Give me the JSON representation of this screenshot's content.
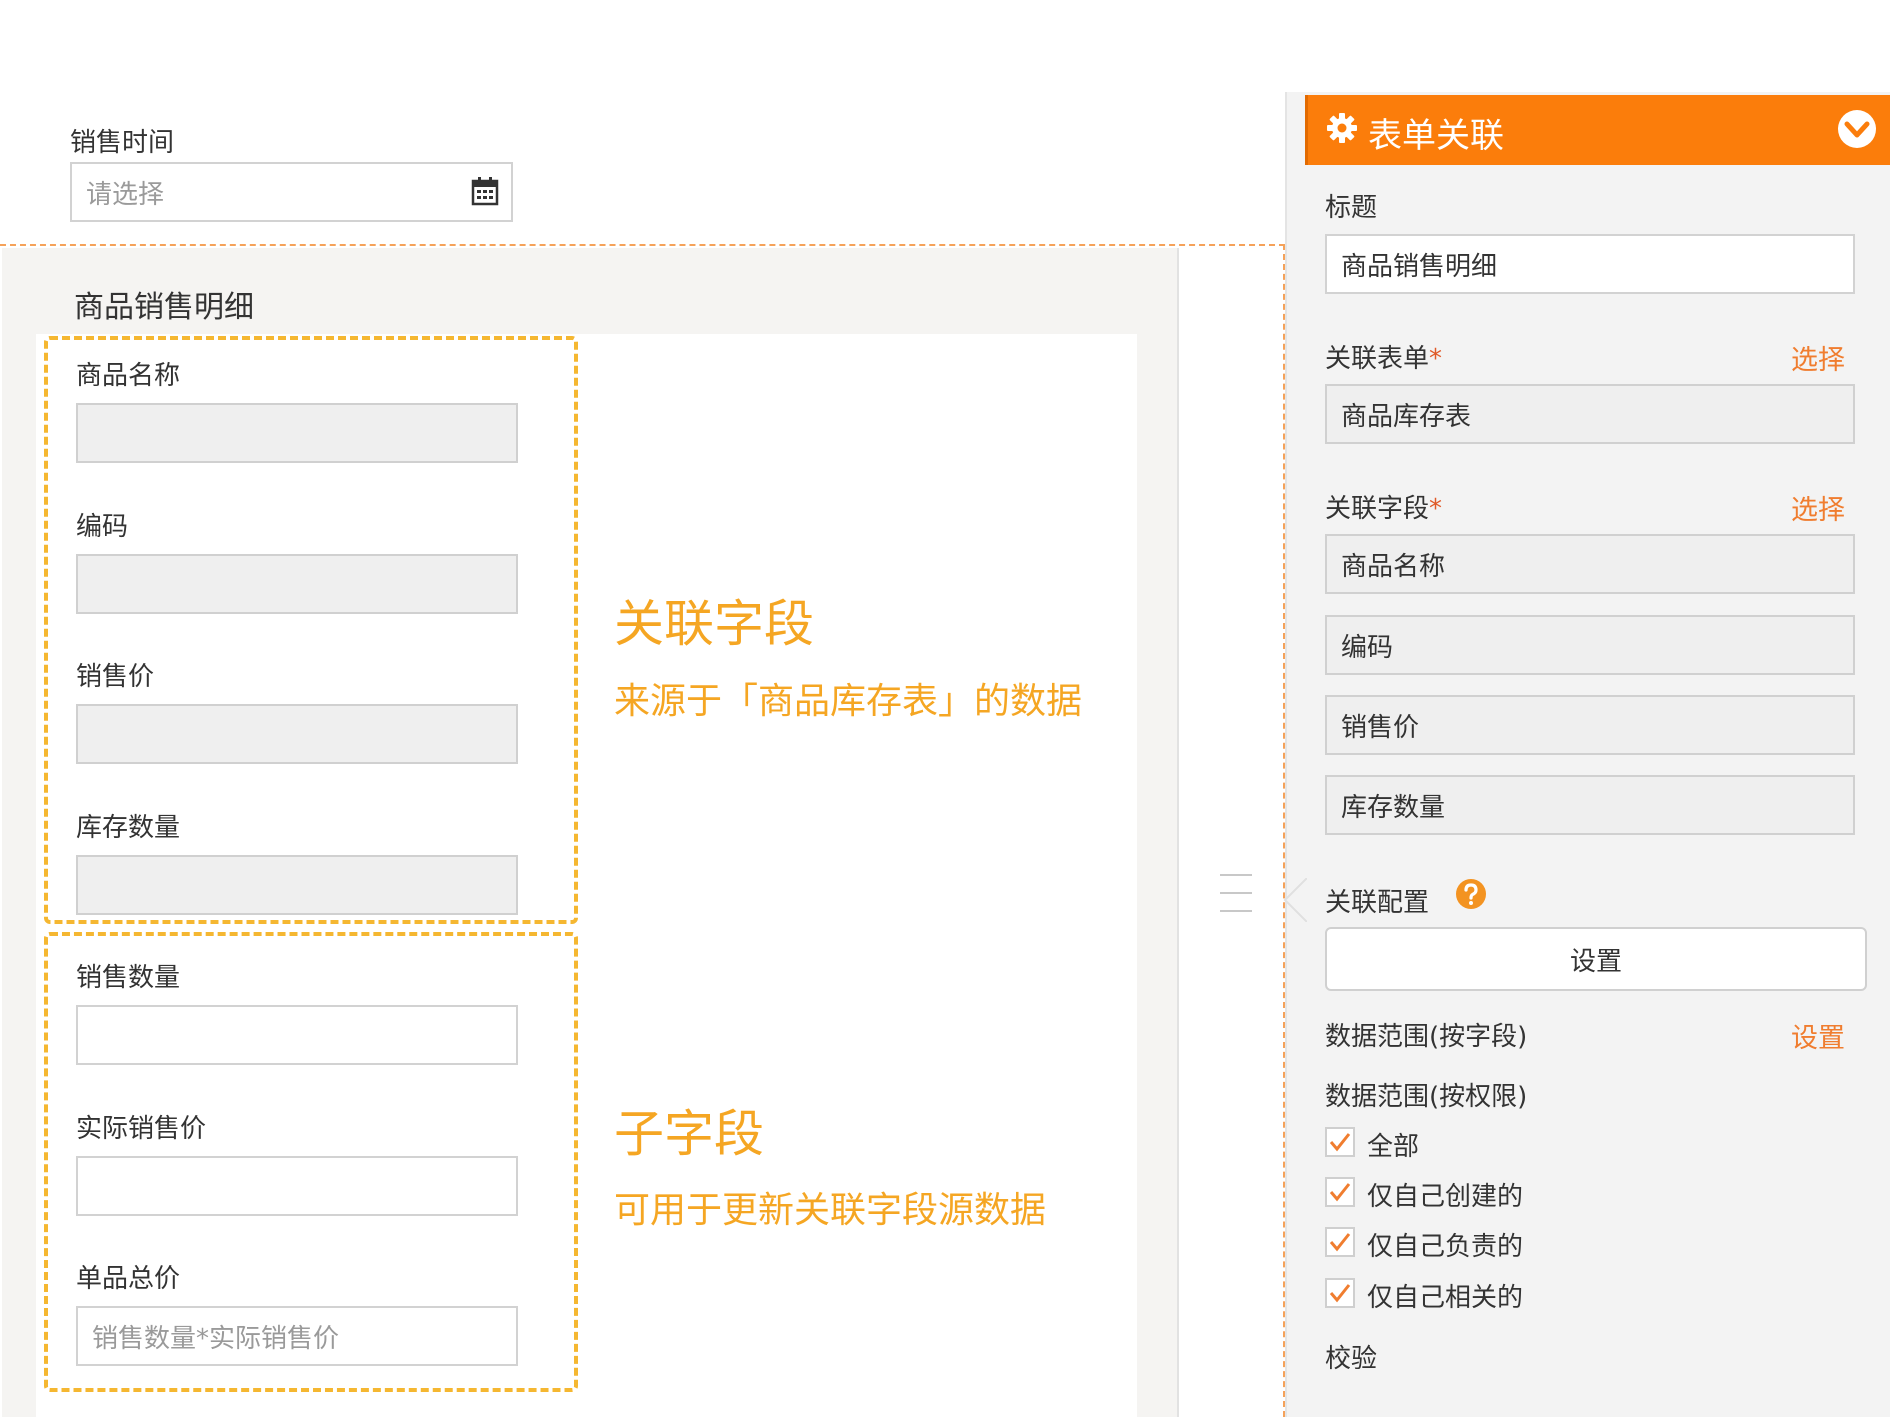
{
  "top_field": {
    "label": "销售时间",
    "placeholder": "请选择",
    "icon": "calendar-icon"
  },
  "subform": {
    "title": "商品销售明细",
    "related_fields": [
      {
        "label": "商品名称",
        "value": ""
      },
      {
        "label": "编码",
        "value": ""
      },
      {
        "label": "销售价",
        "value": ""
      },
      {
        "label": "库存数量",
        "value": ""
      }
    ],
    "child_fields": [
      {
        "label": "销售数量",
        "value": ""
      },
      {
        "label": "实际销售价",
        "value": ""
      },
      {
        "label": "单品总价",
        "placeholder": "销售数量*实际销售价"
      }
    ]
  },
  "annotations": {
    "related": {
      "title": "关联字段",
      "subtitle": "来源于「商品库存表」的数据"
    },
    "child": {
      "title": "子字段",
      "subtitle": "可用于更新关联字段源数据"
    }
  },
  "panel": {
    "header": {
      "title": "表单关联",
      "icon": "gear-icon",
      "collapse_icon": "chevron-down-icon"
    },
    "title_label": "标题",
    "title_value": "商品销售明细",
    "related_form": {
      "label": "关联表单",
      "required_mark": "*",
      "select_link": "选择",
      "value": "商品库存表"
    },
    "related_fields": {
      "label": "关联字段",
      "required_mark": "*",
      "select_link": "选择",
      "items": [
        "商品名称",
        "编码",
        "销售价",
        "库存数量"
      ]
    },
    "config": {
      "label": "关联配置",
      "help_icon": "question-icon",
      "button_label": "设置"
    },
    "data_scope_field": {
      "label": "数据范围(按字段)",
      "link": "设置"
    },
    "data_scope_permission": {
      "label": "数据范围(按权限)",
      "options": [
        {
          "label": "全部",
          "checked": true
        },
        {
          "label": "仅自己创建的",
          "checked": true
        },
        {
          "label": "仅自己负责的",
          "checked": true
        },
        {
          "label": "仅自己相关的",
          "checked": true
        }
      ]
    },
    "validation_label": "校验"
  },
  "colors": {
    "accent": "#fb7d0b",
    "annotation": "#f5a623",
    "link": "#f07d2f"
  }
}
